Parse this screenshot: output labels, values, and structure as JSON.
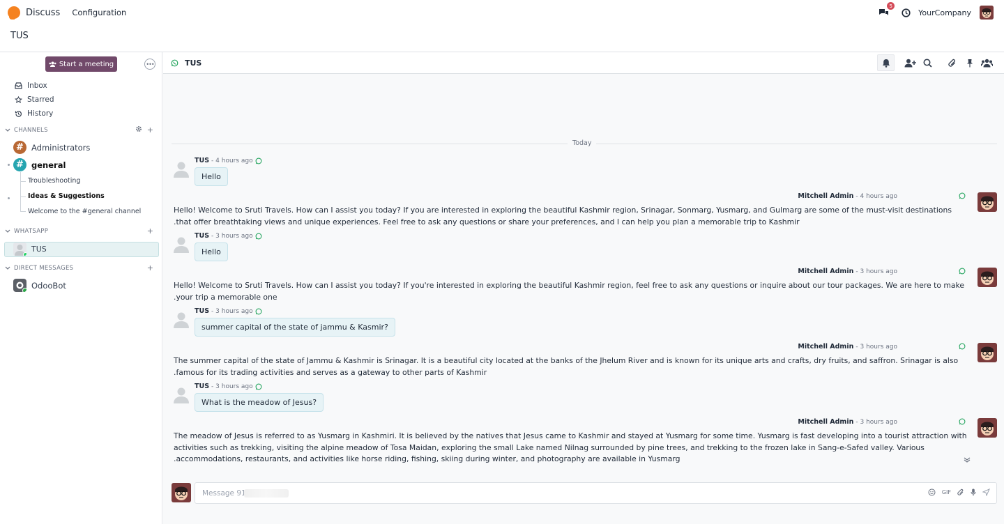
{
  "app": {
    "name": "Discuss",
    "menu": "Configuration",
    "company": "YourCompany",
    "chat_badge": "5"
  },
  "breadcrumb": "TUS",
  "sidebar": {
    "meeting_label": "Start a meeting",
    "more": "•••",
    "mailboxes": [
      {
        "label": "Inbox",
        "icon": "inbox-icon"
      },
      {
        "label": "Starred",
        "icon": "star-icon"
      },
      {
        "label": "History",
        "icon": "history-icon"
      }
    ],
    "channels_title": "CHANNELS",
    "channels": [
      {
        "label": "Administrators",
        "color": "#b86834"
      },
      {
        "label": "general",
        "color": "#26a5b0"
      }
    ],
    "threads": [
      "Troubleshooting",
      "Ideas & Suggestions",
      "Welcome to the #general channel"
    ],
    "whatsapp_title": "WHATSAPP",
    "whatsapp": [
      {
        "label": "TUS"
      }
    ],
    "dm_title": "DIRECT MESSAGES",
    "dms": [
      {
        "label": "OdooBot"
      }
    ]
  },
  "thread": {
    "title": "TUS",
    "today": "Today"
  },
  "messages": [
    {
      "type": "in",
      "author": "TUS",
      "time": "- 4 hours ago",
      "text": "Hello"
    },
    {
      "type": "out",
      "author": "Mitchell Admin",
      "time": "- 4 hours ago",
      "text": "Hello! Welcome to Sruti Travels. How can I assist you today? If you are interested in exploring the beautiful Kashmir region, Srinagar, Sonmarg, Yusmarg, and Gulmarg are some of the must-visit destinations that offer breathtaking views and unique experiences. Feel free to ask any questions or share your preferences, and I can help you plan a memorable trip to Kashmir."
    },
    {
      "type": "in",
      "author": "TUS",
      "time": "- 3 hours ago",
      "text": "Hello"
    },
    {
      "type": "out",
      "author": "Mitchell Admin",
      "time": "- 3 hours ago",
      "text": "Hello! Welcome to Sruti Travels. How can I assist you today? If you're interested in exploring the beautiful Kashmir region, feel free to ask any questions or inquire about our tour packages. We are here to make your trip a memorable one."
    },
    {
      "type": "in",
      "author": "TUS",
      "time": "- 3 hours ago",
      "text": "summer capital of the state of jammu & Kasmir?"
    },
    {
      "type": "out",
      "author": "Mitchell Admin",
      "time": "- 3 hours ago",
      "text": "The summer capital of the state of Jammu & Kashmir is Srinagar. It is a beautiful city located at the banks of the Jhelum River and is known for its unique arts and crafts, dry fruits, and saffron. Srinagar is also famous for its trading activities and serves as a gateway to other parts of Kashmir."
    },
    {
      "type": "in",
      "author": "TUS",
      "time": "- 3 hours ago",
      "text": "What is the meadow of Jesus?"
    },
    {
      "type": "out",
      "author": "Mitchell Admin",
      "time": "- 3 hours ago",
      "text": "The meadow of Jesus is referred to as Yusmarg in Kashmiri. It is believed by the natives that Jesus came to Kashmir and stayed at Yusmarg for some time. Yusmarg is fast developing into a tourist attraction with activities such as trekking, visiting the alpine meadow of Tosa Maidan, exploring the small Lake named Nilnag surrounded by pine trees, and trekking to the frozen lake in Sang-e-Safed valley. Various accommodations, restaurants, and activities like horse riding, fishing, skiing during winter, and photography are available in Yusmarg."
    }
  ],
  "composer": {
    "placeholder": "Message 91",
    "gif": "GIF"
  }
}
